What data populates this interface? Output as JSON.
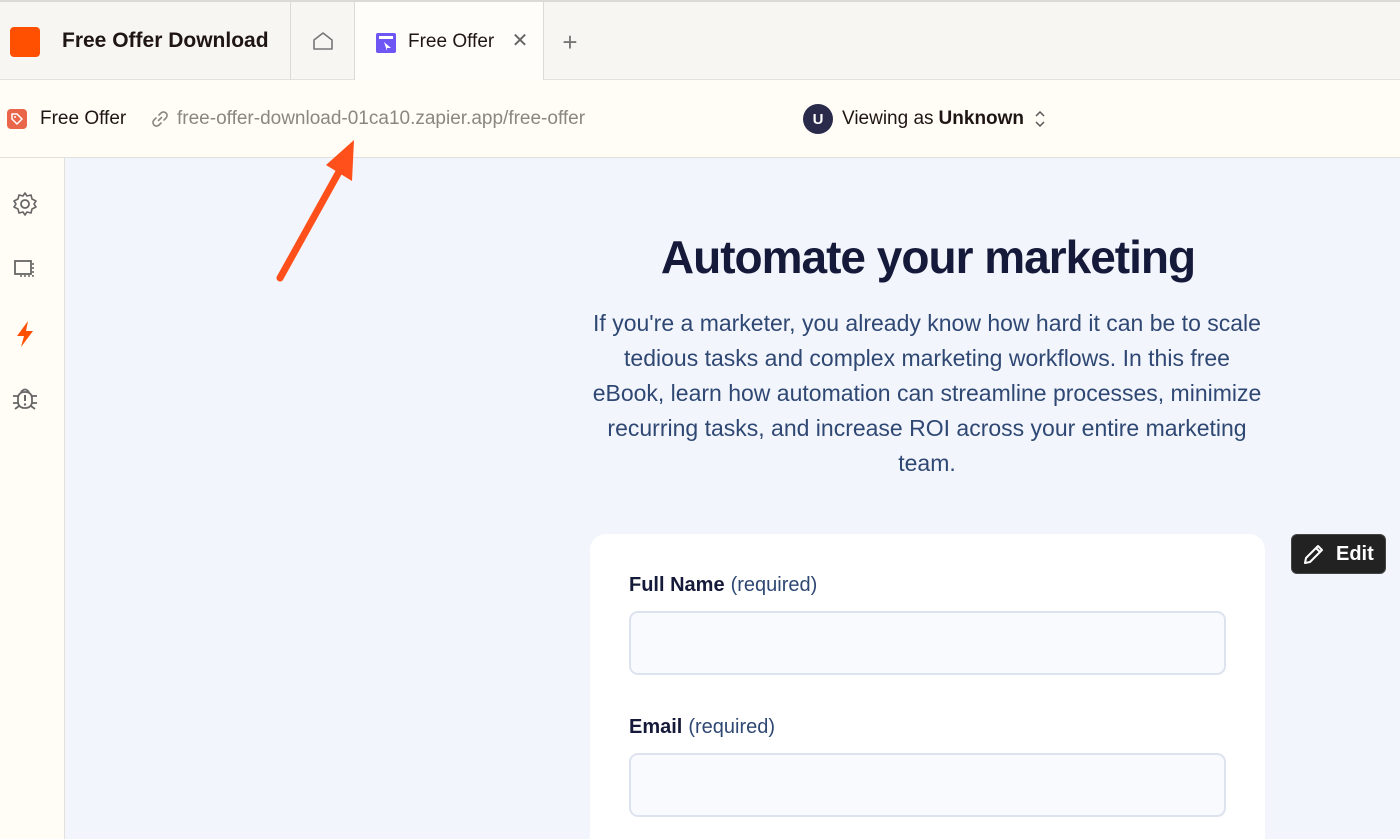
{
  "app": {
    "title": "Free Offer Download",
    "brand_color": "#ff4f00"
  },
  "tabs": {
    "home_icon": "home-icon",
    "active_label": "Free Offer",
    "active_icon": "page-icon",
    "close_icon": "close-icon",
    "add_label": "+"
  },
  "infobar": {
    "page_name": "Free Offer",
    "url": "free-offer-download-01ca10.zapier.app/free-offer",
    "viewing_prefix": "Viewing as",
    "viewing_user": "Unknown",
    "avatar_letter": "U"
  },
  "sidebar": {
    "items": [
      {
        "icon": "gear-icon"
      },
      {
        "icon": "display-icon"
      },
      {
        "icon": "bolt-icon"
      },
      {
        "icon": "bug-icon"
      }
    ]
  },
  "main": {
    "headline": "Automate your marketing",
    "intro": "If you're a marketer, you already know how hard it can be to scale tedious tasks and complex marketing workflows. In this free eBook, learn how automation can streamline processes, minimize recurring tasks, and increase ROI across your entire marketing team.",
    "form": {
      "fields": [
        {
          "label": "Full Name",
          "required_text": "(required)",
          "value": ""
        },
        {
          "label": "Email",
          "required_text": "(required)",
          "value": ""
        }
      ]
    },
    "edit_label": "Edit"
  },
  "annotation": {
    "arrow_color": "#ff4f1a"
  }
}
